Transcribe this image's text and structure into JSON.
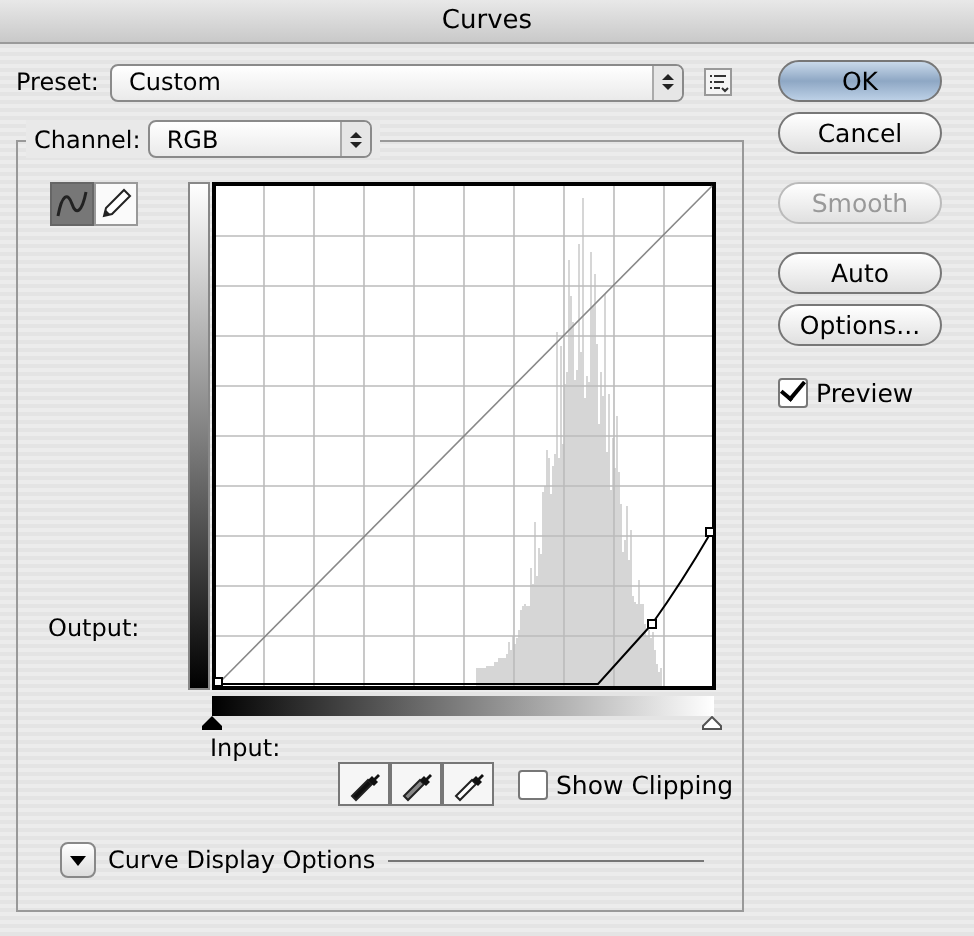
{
  "window": {
    "title": "Curves"
  },
  "preset": {
    "label": "Preset:",
    "value": "Custom"
  },
  "channel": {
    "label": "Channel:",
    "value": "RGB"
  },
  "tools": [
    {
      "kind": "curve",
      "selected": true
    },
    {
      "kind": "pencil",
      "selected": false
    }
  ],
  "graph": {
    "output_label": "Output:",
    "input_label": "Input:"
  },
  "input_sliders": [
    {
      "kind": "shadow",
      "level": 0
    },
    {
      "kind": "highlight",
      "level": 1
    }
  ],
  "eyedroppers": [
    {
      "kind": "black"
    },
    {
      "kind": "gray"
    },
    {
      "kind": "white"
    }
  ],
  "show_clipping": {
    "label": "Show Clipping",
    "checked": false
  },
  "display_options": {
    "label": "Curve Display Options",
    "expanded": false
  },
  "buttons": [
    {
      "label": "OK",
      "default": true,
      "disabled": false
    },
    {
      "label": "Cancel",
      "default": false,
      "disabled": false
    },
    {
      "label": "Smooth",
      "default": false,
      "disabled": true
    },
    {
      "label": "Auto",
      "default": false,
      "disabled": false
    },
    {
      "label": "Options...",
      "default": false,
      "disabled": false
    }
  ],
  "preview": {
    "label": "Preview",
    "checked": true
  }
}
